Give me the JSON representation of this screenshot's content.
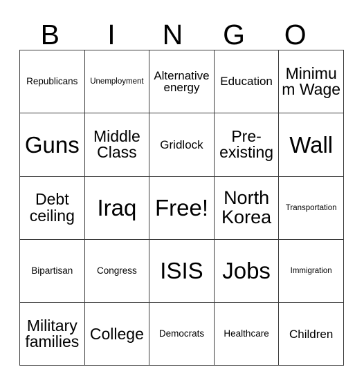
{
  "card": {
    "header_letters": [
      "B",
      "I",
      "N",
      "G",
      "O"
    ],
    "border_color": "#3b3b3b",
    "text_color": "#000000",
    "background_color": "#ffffff",
    "rows": [
      [
        {
          "label": "Republicans",
          "size": "fs-s"
        },
        {
          "label": "Unemployment",
          "size": "fs-xs"
        },
        {
          "label": "Alternative energy",
          "size": "fs-m"
        },
        {
          "label": "Education",
          "size": "fs-m"
        },
        {
          "label": "Minimum Wage",
          "size": "fs-l"
        }
      ],
      [
        {
          "label": "Guns",
          "size": "fs-xxl"
        },
        {
          "label": "Middle Class",
          "size": "fs-l"
        },
        {
          "label": "Gridlock",
          "size": "fs-m"
        },
        {
          "label": "Pre-existing",
          "size": "fs-l"
        },
        {
          "label": "Wall",
          "size": "fs-xxl"
        }
      ],
      [
        {
          "label": "Debt ceiling",
          "size": "fs-l"
        },
        {
          "label": "Iraq",
          "size": "fs-xxl"
        },
        {
          "label": "Free!",
          "size": "fs-xxl"
        },
        {
          "label": "North Korea",
          "size": "fs-xl"
        },
        {
          "label": "Transportation",
          "size": "fs-xs"
        }
      ],
      [
        {
          "label": "Bipartisan",
          "size": "fs-s"
        },
        {
          "label": "Congress",
          "size": "fs-s"
        },
        {
          "label": "ISIS",
          "size": "fs-xxl"
        },
        {
          "label": "Jobs",
          "size": "fs-xxl"
        },
        {
          "label": "Immigration",
          "size": "fs-xs"
        }
      ],
      [
        {
          "label": "Military families",
          "size": "fs-l"
        },
        {
          "label": "College",
          "size": "fs-l"
        },
        {
          "label": "Democrats",
          "size": "fs-s"
        },
        {
          "label": "Healthcare",
          "size": "fs-s"
        },
        {
          "label": "Children",
          "size": "fs-m"
        }
      ]
    ]
  }
}
